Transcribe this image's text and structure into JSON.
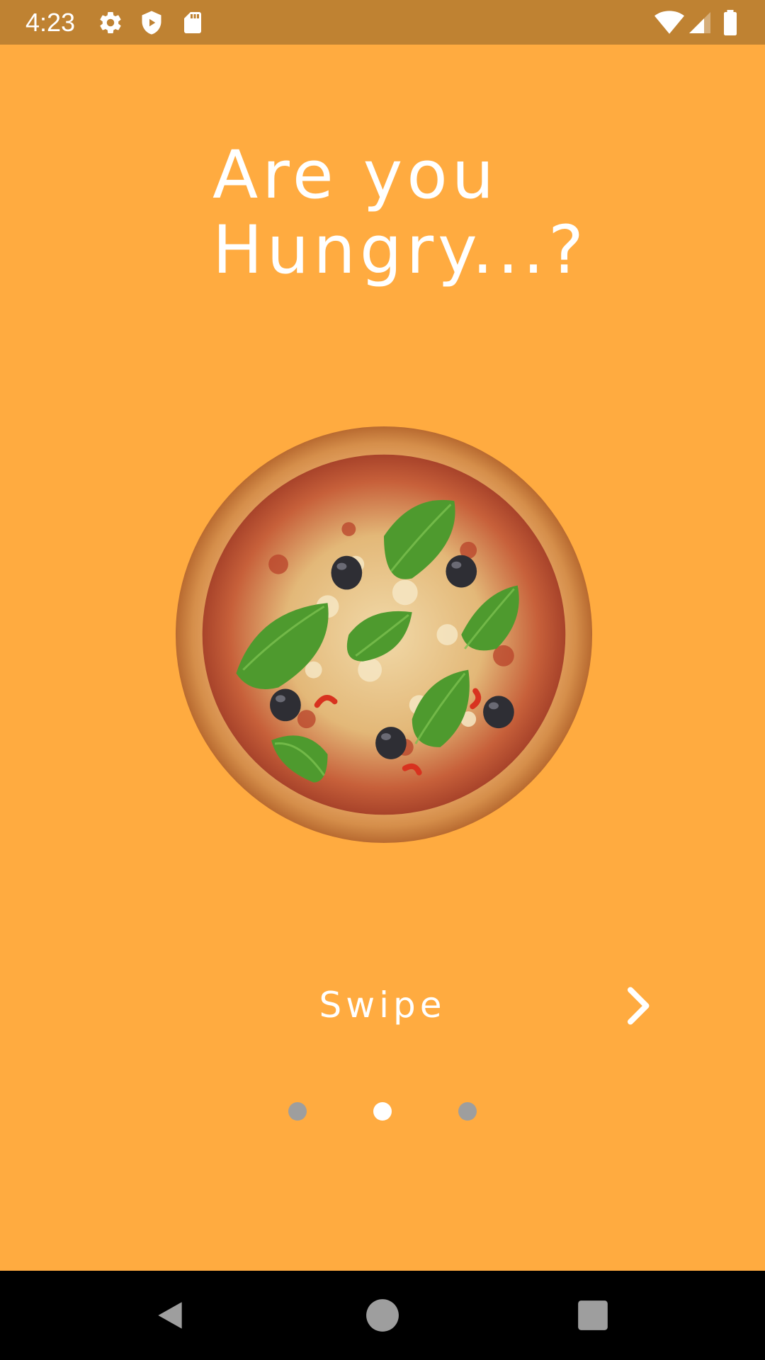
{
  "status_bar": {
    "time": "4:23",
    "left_icons": [
      "settings-icon",
      "shield-icon",
      "sd-card-icon"
    ],
    "right_icons": [
      "wifi-icon",
      "signal-icon",
      "battery-icon"
    ]
  },
  "onboarding": {
    "title_line1": "Are you",
    "title_line2": "Hungry...?",
    "image": "pizza-image",
    "swipe_label": "Swipe",
    "next_icon": "chevron-right-icon",
    "page_indicator": {
      "total": 3,
      "current": 2
    }
  },
  "nav_bar": {
    "buttons": [
      "back-icon",
      "home-icon",
      "recents-icon"
    ]
  },
  "colors": {
    "background": "#FFAB40",
    "status_bar": "#BF8232",
    "text": "#FFFFFF",
    "dot_inactive": "#9E9E9E",
    "dot_active": "#FFFFFF"
  }
}
